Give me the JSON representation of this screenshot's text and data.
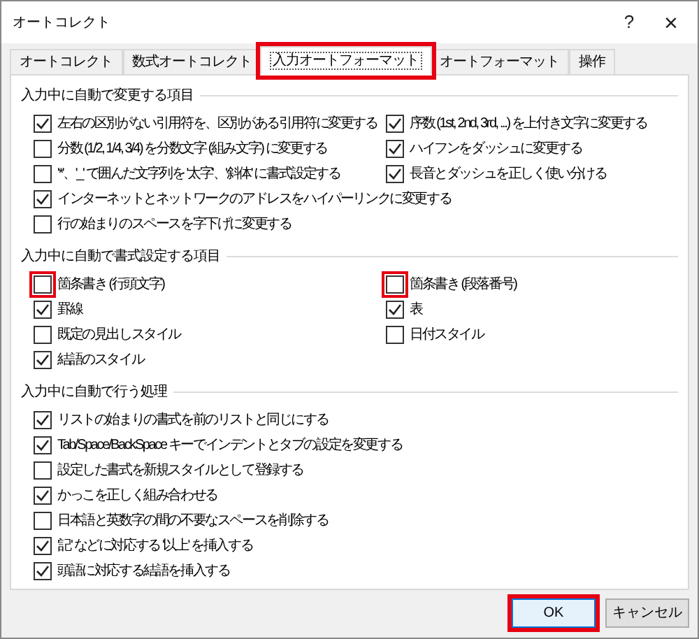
{
  "window": {
    "title": "オートコレクト",
    "help": "?",
    "close": "×"
  },
  "tabs": [
    {
      "label": "オートコレクト",
      "selected": false,
      "highlighted": false
    },
    {
      "label": "数式オートコレクト",
      "selected": false,
      "highlighted": false
    },
    {
      "label": "入力オートフォーマット",
      "selected": true,
      "highlighted": true
    },
    {
      "label": "オートフォーマット",
      "selected": false,
      "highlighted": false
    },
    {
      "label": "操作",
      "selected": false,
      "highlighted": false
    }
  ],
  "sections": [
    {
      "title": "入力中に自動で変更する項目",
      "rows": [
        [
          {
            "label": "左右の区別がない引用符を、区別がある引用符に変更する",
            "checked": true,
            "highlighted": false
          },
          {
            "label": "序数 (1st, 2nd, 3rd, ...) を上付き文字に変更する",
            "checked": true,
            "highlighted": false
          }
        ],
        [
          {
            "label": "分数 (1/2, 1/4, 3/4) を分数文字 (組み文字) に変更する",
            "checked": false,
            "highlighted": false
          },
          {
            "label": "ハイフンをダッシュに変更する",
            "checked": true,
            "highlighted": false
          }
        ],
        [
          {
            "label": "'*'、'_' で囲んだ文字列を '太字'、'斜体' に書式設定する",
            "checked": false,
            "highlighted": false
          },
          {
            "label": "長音とダッシュを正しく使い分ける",
            "checked": true,
            "highlighted": false
          }
        ],
        [
          {
            "label": "インターネットとネットワークのアドレスをハイパーリンクに変更する",
            "checked": true,
            "highlighted": false
          }
        ],
        [
          {
            "label": "行の始まりのスペースを字下げに変更する",
            "checked": false,
            "highlighted": false
          }
        ]
      ]
    },
    {
      "title": "入力中に自動で書式設定する項目",
      "rows": [
        [
          {
            "label": "箇条書き (行頭文字)",
            "checked": false,
            "highlighted": true
          },
          {
            "label": "箇条書き (段落番号)",
            "checked": false,
            "highlighted": true
          }
        ],
        [
          {
            "label": "罫線",
            "checked": true,
            "highlighted": false
          },
          {
            "label": "表",
            "checked": true,
            "highlighted": false
          }
        ],
        [
          {
            "label": "既定の見出しスタイル",
            "checked": false,
            "highlighted": false
          },
          {
            "label": "日付スタイル",
            "checked": false,
            "highlighted": false
          }
        ],
        [
          {
            "label": "結語のスタイル",
            "checked": true,
            "highlighted": false
          }
        ]
      ]
    },
    {
      "title": "入力中に自動で行う処理",
      "rows": [
        [
          {
            "label": "リストの始まりの書式を前のリストと同じにする",
            "checked": true,
            "highlighted": false
          }
        ],
        [
          {
            "label": "Tab/Space/BackSpace キーでインデントとタブの設定を変更する",
            "checked": true,
            "highlighted": false
          }
        ],
        [
          {
            "label": "設定した書式を新規スタイルとして登録する",
            "checked": false,
            "highlighted": false
          }
        ],
        [
          {
            "label": "かっこを正しく組み合わせる",
            "checked": true,
            "highlighted": false
          }
        ],
        [
          {
            "label": "日本語と英数字の間の不要なスペースを削除する",
            "checked": false,
            "highlighted": false
          }
        ],
        [
          {
            "label": "'記' などに対応する '以上' を挿入する",
            "checked": true,
            "highlighted": false
          }
        ],
        [
          {
            "label": "頭語に対応する結語を挿入する",
            "checked": true,
            "highlighted": false
          }
        ]
      ]
    }
  ],
  "buttons": [
    {
      "label": "OK",
      "default": true,
      "highlighted": true
    },
    {
      "label": "キャンセル",
      "default": false,
      "highlighted": false
    }
  ]
}
